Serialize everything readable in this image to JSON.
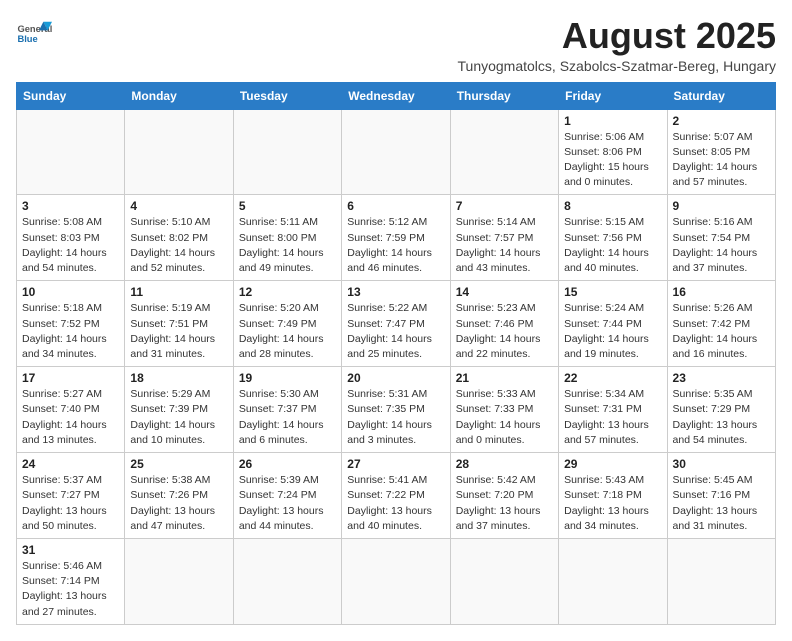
{
  "logo": {
    "line1": "General",
    "line2": "Blue"
  },
  "title": "August 2025",
  "subtitle": "Tunyogmatolcs, Szabolcs-Szatmar-Bereg, Hungary",
  "weekdays": [
    "Sunday",
    "Monday",
    "Tuesday",
    "Wednesday",
    "Thursday",
    "Friday",
    "Saturday"
  ],
  "weeks": [
    [
      {
        "day": "",
        "info": ""
      },
      {
        "day": "",
        "info": ""
      },
      {
        "day": "",
        "info": ""
      },
      {
        "day": "",
        "info": ""
      },
      {
        "day": "",
        "info": ""
      },
      {
        "day": "1",
        "info": "Sunrise: 5:06 AM\nSunset: 8:06 PM\nDaylight: 15 hours and 0 minutes."
      },
      {
        "day": "2",
        "info": "Sunrise: 5:07 AM\nSunset: 8:05 PM\nDaylight: 14 hours and 57 minutes."
      }
    ],
    [
      {
        "day": "3",
        "info": "Sunrise: 5:08 AM\nSunset: 8:03 PM\nDaylight: 14 hours and 54 minutes."
      },
      {
        "day": "4",
        "info": "Sunrise: 5:10 AM\nSunset: 8:02 PM\nDaylight: 14 hours and 52 minutes."
      },
      {
        "day": "5",
        "info": "Sunrise: 5:11 AM\nSunset: 8:00 PM\nDaylight: 14 hours and 49 minutes."
      },
      {
        "day": "6",
        "info": "Sunrise: 5:12 AM\nSunset: 7:59 PM\nDaylight: 14 hours and 46 minutes."
      },
      {
        "day": "7",
        "info": "Sunrise: 5:14 AM\nSunset: 7:57 PM\nDaylight: 14 hours and 43 minutes."
      },
      {
        "day": "8",
        "info": "Sunrise: 5:15 AM\nSunset: 7:56 PM\nDaylight: 14 hours and 40 minutes."
      },
      {
        "day": "9",
        "info": "Sunrise: 5:16 AM\nSunset: 7:54 PM\nDaylight: 14 hours and 37 minutes."
      }
    ],
    [
      {
        "day": "10",
        "info": "Sunrise: 5:18 AM\nSunset: 7:52 PM\nDaylight: 14 hours and 34 minutes."
      },
      {
        "day": "11",
        "info": "Sunrise: 5:19 AM\nSunset: 7:51 PM\nDaylight: 14 hours and 31 minutes."
      },
      {
        "day": "12",
        "info": "Sunrise: 5:20 AM\nSunset: 7:49 PM\nDaylight: 14 hours and 28 minutes."
      },
      {
        "day": "13",
        "info": "Sunrise: 5:22 AM\nSunset: 7:47 PM\nDaylight: 14 hours and 25 minutes."
      },
      {
        "day": "14",
        "info": "Sunrise: 5:23 AM\nSunset: 7:46 PM\nDaylight: 14 hours and 22 minutes."
      },
      {
        "day": "15",
        "info": "Sunrise: 5:24 AM\nSunset: 7:44 PM\nDaylight: 14 hours and 19 minutes."
      },
      {
        "day": "16",
        "info": "Sunrise: 5:26 AM\nSunset: 7:42 PM\nDaylight: 14 hours and 16 minutes."
      }
    ],
    [
      {
        "day": "17",
        "info": "Sunrise: 5:27 AM\nSunset: 7:40 PM\nDaylight: 14 hours and 13 minutes."
      },
      {
        "day": "18",
        "info": "Sunrise: 5:29 AM\nSunset: 7:39 PM\nDaylight: 14 hours and 10 minutes."
      },
      {
        "day": "19",
        "info": "Sunrise: 5:30 AM\nSunset: 7:37 PM\nDaylight: 14 hours and 6 minutes."
      },
      {
        "day": "20",
        "info": "Sunrise: 5:31 AM\nSunset: 7:35 PM\nDaylight: 14 hours and 3 minutes."
      },
      {
        "day": "21",
        "info": "Sunrise: 5:33 AM\nSunset: 7:33 PM\nDaylight: 14 hours and 0 minutes."
      },
      {
        "day": "22",
        "info": "Sunrise: 5:34 AM\nSunset: 7:31 PM\nDaylight: 13 hours and 57 minutes."
      },
      {
        "day": "23",
        "info": "Sunrise: 5:35 AM\nSunset: 7:29 PM\nDaylight: 13 hours and 54 minutes."
      }
    ],
    [
      {
        "day": "24",
        "info": "Sunrise: 5:37 AM\nSunset: 7:27 PM\nDaylight: 13 hours and 50 minutes."
      },
      {
        "day": "25",
        "info": "Sunrise: 5:38 AM\nSunset: 7:26 PM\nDaylight: 13 hours and 47 minutes."
      },
      {
        "day": "26",
        "info": "Sunrise: 5:39 AM\nSunset: 7:24 PM\nDaylight: 13 hours and 44 minutes."
      },
      {
        "day": "27",
        "info": "Sunrise: 5:41 AM\nSunset: 7:22 PM\nDaylight: 13 hours and 40 minutes."
      },
      {
        "day": "28",
        "info": "Sunrise: 5:42 AM\nSunset: 7:20 PM\nDaylight: 13 hours and 37 minutes."
      },
      {
        "day": "29",
        "info": "Sunrise: 5:43 AM\nSunset: 7:18 PM\nDaylight: 13 hours and 34 minutes."
      },
      {
        "day": "30",
        "info": "Sunrise: 5:45 AM\nSunset: 7:16 PM\nDaylight: 13 hours and 31 minutes."
      }
    ],
    [
      {
        "day": "31",
        "info": "Sunrise: 5:46 AM\nSunset: 7:14 PM\nDaylight: 13 hours and 27 minutes."
      },
      {
        "day": "",
        "info": ""
      },
      {
        "day": "",
        "info": ""
      },
      {
        "day": "",
        "info": ""
      },
      {
        "day": "",
        "info": ""
      },
      {
        "day": "",
        "info": ""
      },
      {
        "day": "",
        "info": ""
      }
    ]
  ]
}
